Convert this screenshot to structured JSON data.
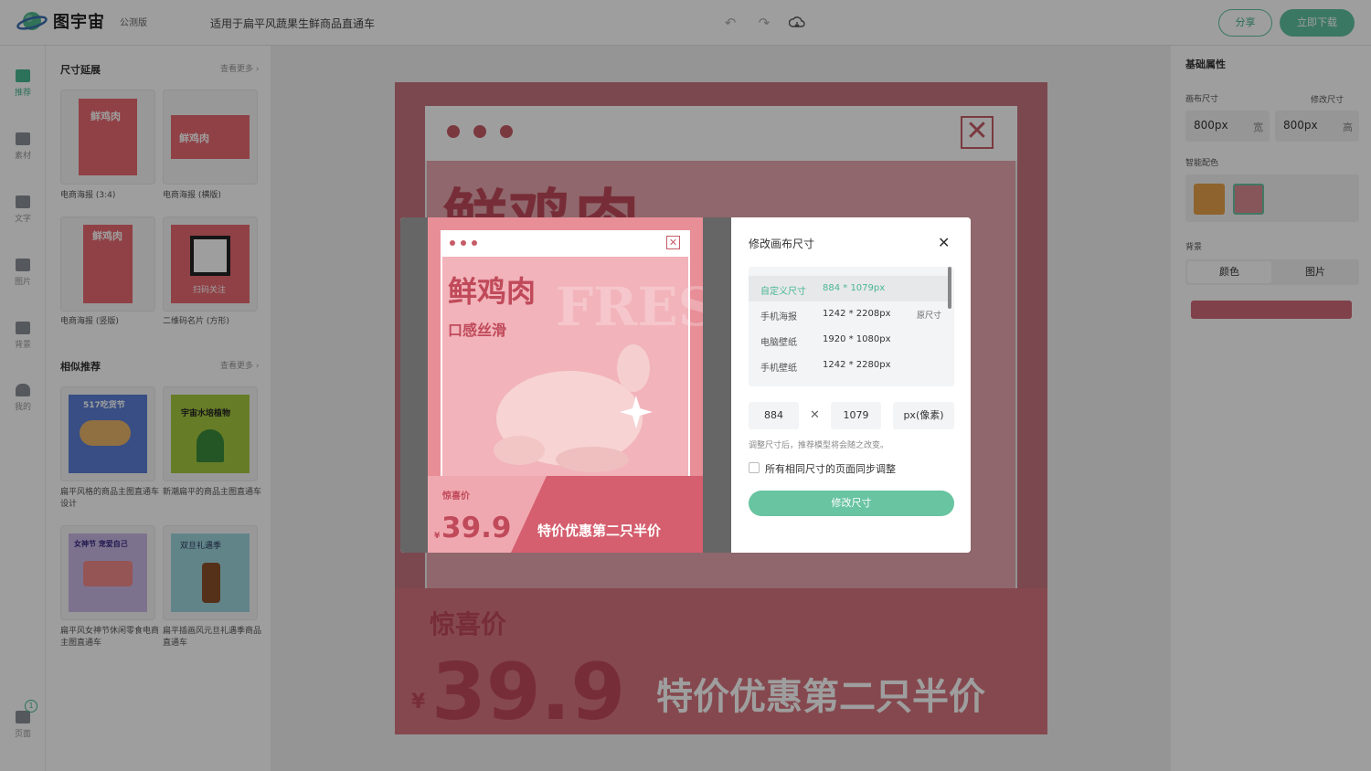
{
  "topbar": {
    "brand": "图宇宙",
    "beta": "公测版",
    "doc_title": "适用于扁平风蔬果生鲜商品直通车",
    "share": "分享",
    "download": "立即下载"
  },
  "rail": [
    {
      "label": "推荐",
      "icon": "recommend-icon"
    },
    {
      "label": "素材",
      "icon": "shapes-icon"
    },
    {
      "label": "文字",
      "icon": "text-icon"
    },
    {
      "label": "图片",
      "icon": "image-icon"
    },
    {
      "label": "背景",
      "icon": "background-icon"
    },
    {
      "label": "我的",
      "icon": "user-icon"
    },
    {
      "label": "页面",
      "icon": "pages-icon"
    }
  ],
  "page_count": "1",
  "side": {
    "size_title": "尺寸延展",
    "see_more": "查看更多",
    "size_items": [
      {
        "caption": "电商海报 (3:4)",
        "thumb_text": "鲜鸡肉"
      },
      {
        "caption": "电商海报 (横版)",
        "thumb_text": "鲜鸡肉"
      },
      {
        "caption": "电商海报 (竖版)",
        "thumb_text": "鲜鸡肉"
      },
      {
        "caption": "二维码名片 (方形)",
        "thumb_text": "扫码关注"
      }
    ],
    "similar_title": "相似推荐",
    "similar_items": [
      {
        "caption": "扁平风格的商品主图直通车设计",
        "thumb_text": "517吃货节"
      },
      {
        "caption": "新潮扁平的商品主图直通车",
        "thumb_text": "宇宙水培植物"
      },
      {
        "caption": "扁平风女神节休闲零食电商主图直通车",
        "thumb_text": "女神节 宠爱自己"
      },
      {
        "caption": "扁平插画风元旦礼遇季商品直通车",
        "thumb_text": "双旦礼遇季"
      }
    ]
  },
  "poster": {
    "headline": "鲜鸡肉",
    "sub": "口感丝滑",
    "bg_word": "FRESH",
    "surprise": "惊喜价",
    "currency": "¥",
    "price": "39.9",
    "promo": "特价优惠第二只半价"
  },
  "right": {
    "title": "基础属性",
    "canvas_size_label": "画布尺寸",
    "modify_size": "修改尺寸",
    "width_value": "800px",
    "width_unit": "宽",
    "height_value": "800px",
    "height_unit": "高",
    "smart_color_label": "智能配色",
    "swatches": [
      "#e6a14a",
      "#d98b93"
    ],
    "bg_label": "背景",
    "bg_tabs": [
      "颜色",
      "图片"
    ],
    "bg_color": "#cf6a78"
  },
  "modal": {
    "title": "修改画布尺寸",
    "presets": [
      {
        "name": "自定义尺寸",
        "size": "884 * 1079px",
        "tag": ""
      },
      {
        "name": "手机海报",
        "size": "1242 * 2208px",
        "tag": "原尺寸"
      },
      {
        "name": "电脑壁纸",
        "size": "1920 * 1080px",
        "tag": ""
      },
      {
        "name": "手机壁纸",
        "size": "1242 * 2280px",
        "tag": ""
      }
    ],
    "width": "884",
    "height": "1079",
    "unit": "px(像素)",
    "hint": "调整尺寸后，推荐模型将会随之改变。",
    "sync_label": "所有相同尺寸的页面同步调整",
    "confirm": "修改尺寸"
  }
}
